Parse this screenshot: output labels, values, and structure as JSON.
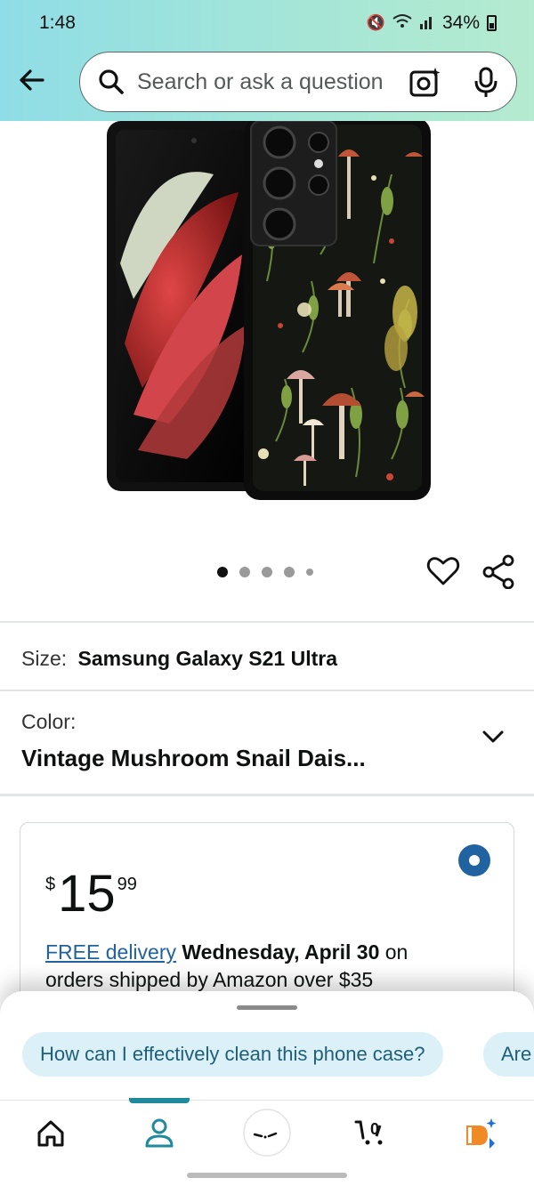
{
  "status_bar": {
    "time": "1:48",
    "battery": "34%"
  },
  "header": {
    "search_placeholder": "Search or ask a question"
  },
  "carousel": {
    "total_images": 5,
    "active_index": 0
  },
  "product": {
    "size_label": "Size:",
    "size_value": "Samsung Galaxy S21 Ultra",
    "color_label": "Color:",
    "color_value": "Vintage Mushroom Snail Dais..."
  },
  "offer": {
    "currency": "$",
    "price_whole": "15",
    "price_fraction": "99",
    "delivery_link": "FREE delivery",
    "delivery_date": "Wednesday, April 30",
    "delivery_rest": " on orders shipped by Amazon over $35"
  },
  "suggestions": [
    "How can I effectively clean this phone case?",
    "Are"
  ],
  "nav": {
    "active": "account",
    "items": [
      "home-icon",
      "account-icon",
      "rufus-icon",
      "cart-icon",
      "menu-icon"
    ]
  },
  "colors": {
    "accent": "#1e8a9c",
    "link": "#2162a1",
    "chip_bg": "#dcf0f8"
  }
}
